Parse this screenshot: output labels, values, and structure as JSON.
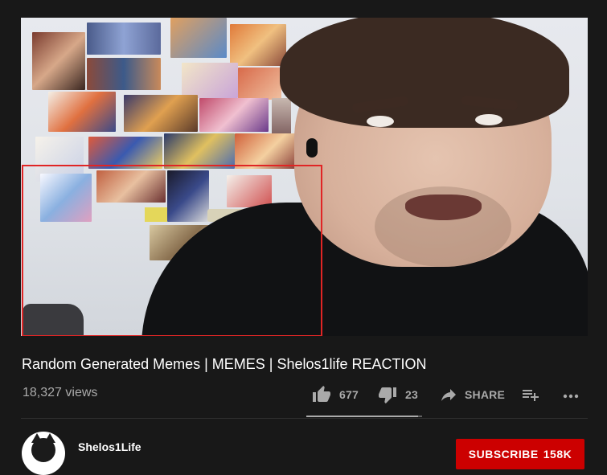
{
  "video": {
    "title": "Random Generated Memes | MEMES | Shelos1life REACTION",
    "views": "18,327 views"
  },
  "actions": {
    "like_count": "677",
    "dislike_count": "23",
    "share_label": "SHARE",
    "like_ratio": 0.967
  },
  "channel": {
    "name": "Shelos1Life",
    "subscribe_label": "SUBSCRIBE",
    "subscriber_count": "158K"
  },
  "icons": [
    "thumb-up-icon",
    "thumb-down-icon",
    "share-icon",
    "add-to-playlist-icon",
    "more-icon"
  ],
  "colors": {
    "background": "#181818",
    "subscribe_red": "#cc0000",
    "highlight_box": "#e02525",
    "secondary_text": "#aaaaaa"
  }
}
